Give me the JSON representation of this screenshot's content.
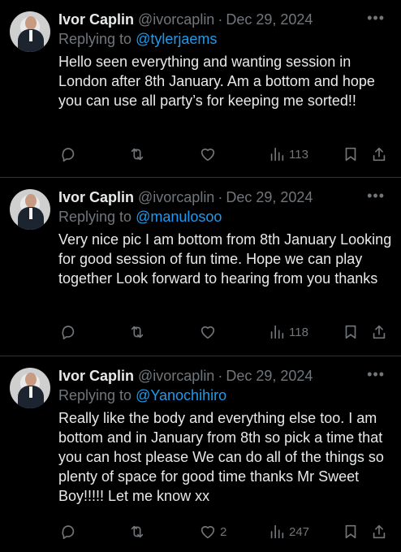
{
  "tweets": [
    {
      "name": "Ivor Caplin",
      "handle": "@ivorcaplin",
      "separator": "·",
      "date": "Dec 29, 2024",
      "replying_prefix": "Replying to",
      "replying_to": "@tylerjaems",
      "text": "Hello seen everything and wanting session in London after 8th January. Am a bottom and hope you can use all party’s for keeping me sorted!!",
      "likes": "",
      "views": "113"
    },
    {
      "name": "Ivor Caplin",
      "handle": "@ivorcaplin",
      "separator": "·",
      "date": "Dec 29, 2024",
      "replying_prefix": "Replying to",
      "replying_to": "@manulosoo",
      "text": "Very nice pic I am bottom from 8th January Looking for good session of fun time. Hope we can play together Look forward to hearing from you thanks",
      "likes": "",
      "views": "118"
    },
    {
      "name": "Ivor Caplin",
      "handle": "@ivorcaplin",
      "separator": "·",
      "date": "Dec 29, 2024",
      "replying_prefix": "Replying to",
      "replying_to": "@Yanochihiro",
      "text": "Really like the body and everything else too. I am bottom and in January from 8th so pick a time that you can host please We can do all of the things so plenty of space for good time thanks Mr Sweet Boy!!!!! Let me know xx",
      "likes": "2",
      "views": "247"
    }
  ],
  "icons": {
    "more": "more-horizontal-icon",
    "reply": "reply-bubble-icon",
    "retweet": "retweet-icon",
    "like": "heart-icon",
    "views": "bar-chart-icon",
    "bookmark": "bookmark-icon",
    "share": "share-upload-icon"
  },
  "colors": {
    "background": "#000000",
    "text": "#e7e9ea",
    "muted": "#71767b",
    "link": "#1d9bf0",
    "divider": "#2f3336"
  }
}
